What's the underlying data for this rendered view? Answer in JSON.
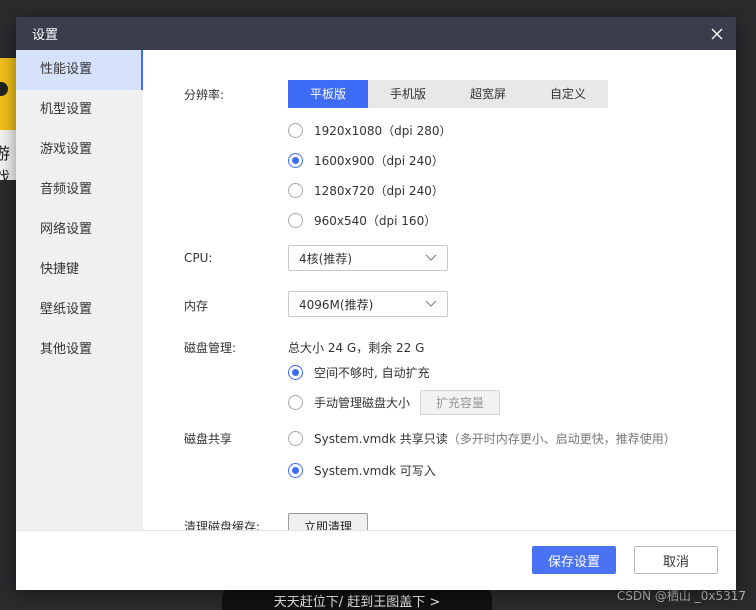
{
  "background": {
    "side_text": "游戏",
    "banner_text": "天天赶位下/ 赶到王图盖下 >",
    "watermark": "CSDN @栖山 _0x5317"
  },
  "dialog": {
    "title": "设置",
    "close_icon": "close-icon"
  },
  "sidebar": {
    "items": [
      {
        "label": "性能设置",
        "active": true
      },
      {
        "label": "机型设置"
      },
      {
        "label": "游戏设置"
      },
      {
        "label": "音频设置"
      },
      {
        "label": "网络设置"
      },
      {
        "label": "快捷键"
      },
      {
        "label": "壁纸设置"
      },
      {
        "label": "其他设置"
      }
    ]
  },
  "resolution": {
    "label": "分辨率:",
    "tabs": [
      "平板版",
      "手机版",
      "超宽屏",
      "自定义"
    ],
    "active_tab": "平板版",
    "options": [
      "1920x1080（dpi 280）",
      "1600x900（dpi 240）",
      "1280x720（dpi 240）",
      "960x540（dpi 160）"
    ],
    "selected": "1600x900（dpi 240）"
  },
  "cpu": {
    "label": "CPU:",
    "value": "4核(推荐)"
  },
  "memory": {
    "label": "内存",
    "value": "4096M(推荐)"
  },
  "disk": {
    "label": "磁盘管理:",
    "summary": "总大小 24 G，剩余 22 G",
    "options": [
      "空间不够时, 自动扩充",
      "手动管理磁盘大小"
    ],
    "selected": "空间不够时, 自动扩充",
    "expand_button": "扩充容量"
  },
  "disk_share": {
    "label": "磁盘共享",
    "option_readonly": "System.vmdk 共享只读",
    "option_readonly_hint": "（多开时内存更小、启动更快，推荐使用）",
    "option_writable": "System.vmdk 可写入",
    "selected": "System.vmdk 可写入"
  },
  "cache": {
    "label": "清理磁盘缓存:",
    "button": "立即清理"
  },
  "footer": {
    "save": "保存设置",
    "cancel": "取消"
  },
  "colors": {
    "accent": "#3e6cf6",
    "titlebar": "#3a3d4b"
  }
}
